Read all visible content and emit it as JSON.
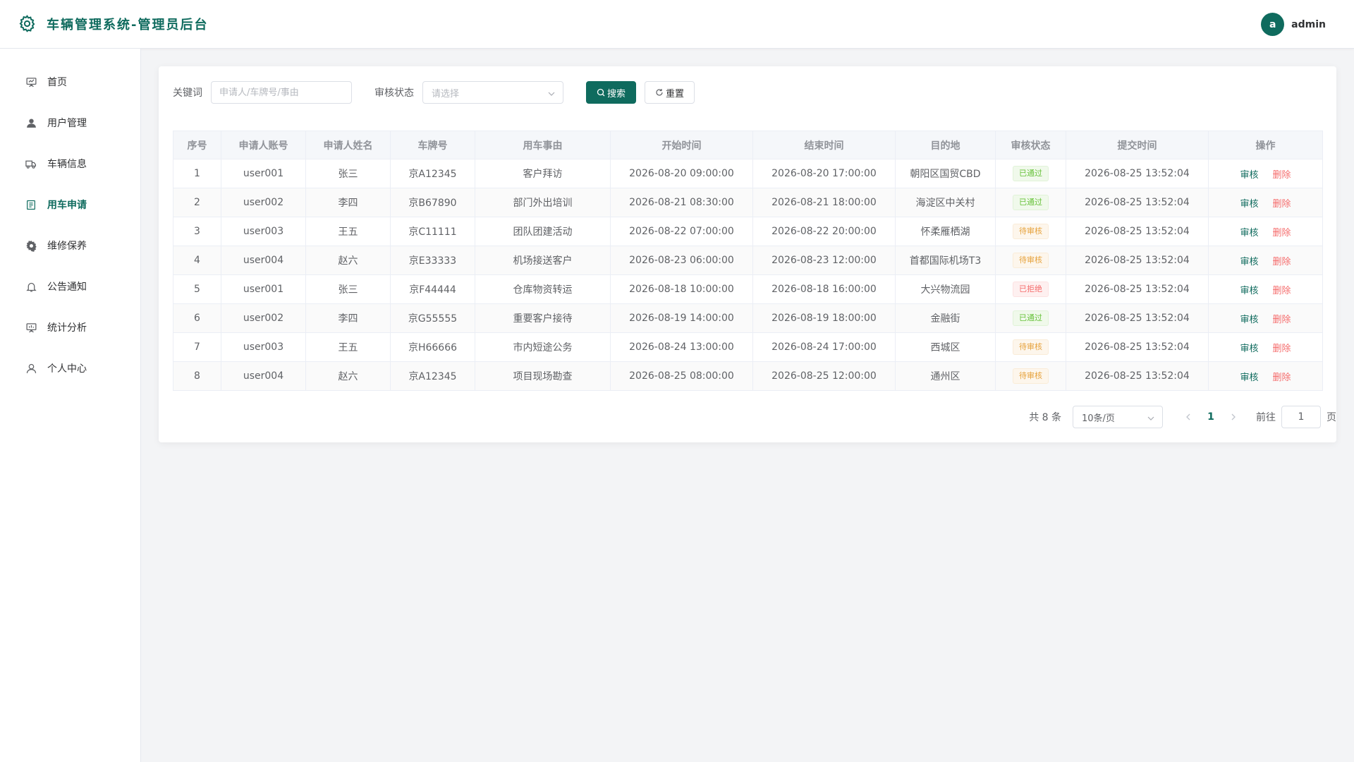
{
  "app": {
    "title": "车辆管理系统-管理员后台",
    "brand_icon": "gear-icon",
    "accent": "#0f6b5e"
  },
  "user": {
    "avatar_letter": "a",
    "name": "admin"
  },
  "sidebar": {
    "items": [
      {
        "label": "首页",
        "icon": "presentation-icon",
        "active": false
      },
      {
        "label": "用户管理",
        "icon": "user-filled-icon",
        "active": false
      },
      {
        "label": "车辆信息",
        "icon": "truck-icon",
        "active": false
      },
      {
        "label": "用车申请",
        "icon": "document-icon",
        "active": true
      },
      {
        "label": "维修保养",
        "icon": "gear-icon",
        "active": false
      },
      {
        "label": "公告通知",
        "icon": "bell-icon",
        "active": false
      },
      {
        "label": "统计分析",
        "icon": "chart-board-icon",
        "active": false
      },
      {
        "label": "个人中心",
        "icon": "user-outline-icon",
        "active": false
      }
    ]
  },
  "search": {
    "keyword_label": "关键词",
    "keyword_placeholder": "申请人/车牌号/事由",
    "keyword_value": "",
    "status_label": "审核状态",
    "status_placeholder": "请选择",
    "search_button": "搜索",
    "reset_button": "重置"
  },
  "table": {
    "columns": [
      "序号",
      "申请人账号",
      "申请人姓名",
      "车牌号",
      "用车事由",
      "开始时间",
      "结束时间",
      "目的地",
      "审核状态",
      "提交时间",
      "操作"
    ],
    "rows": [
      {
        "no": "1",
        "account": "user001",
        "name": "张三",
        "plate": "京A12345",
        "reason": "客户拜访",
        "start": "2026-08-20 09:00:00",
        "end": "2026-08-20 17:00:00",
        "dest": "朝阳区国贸CBD",
        "status": "已通过",
        "status_type": "success",
        "submitted": "2026-08-25 13:52:04"
      },
      {
        "no": "2",
        "account": "user002",
        "name": "李四",
        "plate": "京B67890",
        "reason": "部门外出培训",
        "start": "2026-08-21 08:30:00",
        "end": "2026-08-21 18:00:00",
        "dest": "海淀区中关村",
        "status": "已通过",
        "status_type": "success",
        "submitted": "2026-08-25 13:52:04"
      },
      {
        "no": "3",
        "account": "user003",
        "name": "王五",
        "plate": "京C11111",
        "reason": "团队团建活动",
        "start": "2026-08-22 07:00:00",
        "end": "2026-08-22 20:00:00",
        "dest": "怀柔雁栖湖",
        "status": "待审核",
        "status_type": "warning",
        "submitted": "2026-08-25 13:52:04"
      },
      {
        "no": "4",
        "account": "user004",
        "name": "赵六",
        "plate": "京E33333",
        "reason": "机场接送客户",
        "start": "2026-08-23 06:00:00",
        "end": "2026-08-23 12:00:00",
        "dest": "首都国际机场T3",
        "status": "待审核",
        "status_type": "warning",
        "submitted": "2026-08-25 13:52:04"
      },
      {
        "no": "5",
        "account": "user001",
        "name": "张三",
        "plate": "京F44444",
        "reason": "仓库物资转运",
        "start": "2026-08-18 10:00:00",
        "end": "2026-08-18 16:00:00",
        "dest": "大兴物流园",
        "status": "已拒绝",
        "status_type": "danger",
        "submitted": "2026-08-25 13:52:04"
      },
      {
        "no": "6",
        "account": "user002",
        "name": "李四",
        "plate": "京G55555",
        "reason": "重要客户接待",
        "start": "2026-08-19 14:00:00",
        "end": "2026-08-19 18:00:00",
        "dest": "金融街",
        "status": "已通过",
        "status_type": "success",
        "submitted": "2026-08-25 13:52:04"
      },
      {
        "no": "7",
        "account": "user003",
        "name": "王五",
        "plate": "京H66666",
        "reason": "市内短途公务",
        "start": "2026-08-24 13:00:00",
        "end": "2026-08-24 17:00:00",
        "dest": "西城区",
        "status": "待审核",
        "status_type": "warning",
        "submitted": "2026-08-25 13:52:04"
      },
      {
        "no": "8",
        "account": "user004",
        "name": "赵六",
        "plate": "京A12345",
        "reason": "项目现场勘查",
        "start": "2026-08-25 08:00:00",
        "end": "2026-08-25 12:00:00",
        "dest": "通州区",
        "status": "待审核",
        "status_type": "warning",
        "submitted": "2026-08-25 13:52:04"
      }
    ],
    "action_review": "审核",
    "action_delete": "删除"
  },
  "pagination": {
    "total_text": "共 8 条",
    "page_size": "10条/页",
    "current_page": "1",
    "goto_label": "前往",
    "goto_value": "1",
    "page_suffix": "页"
  }
}
